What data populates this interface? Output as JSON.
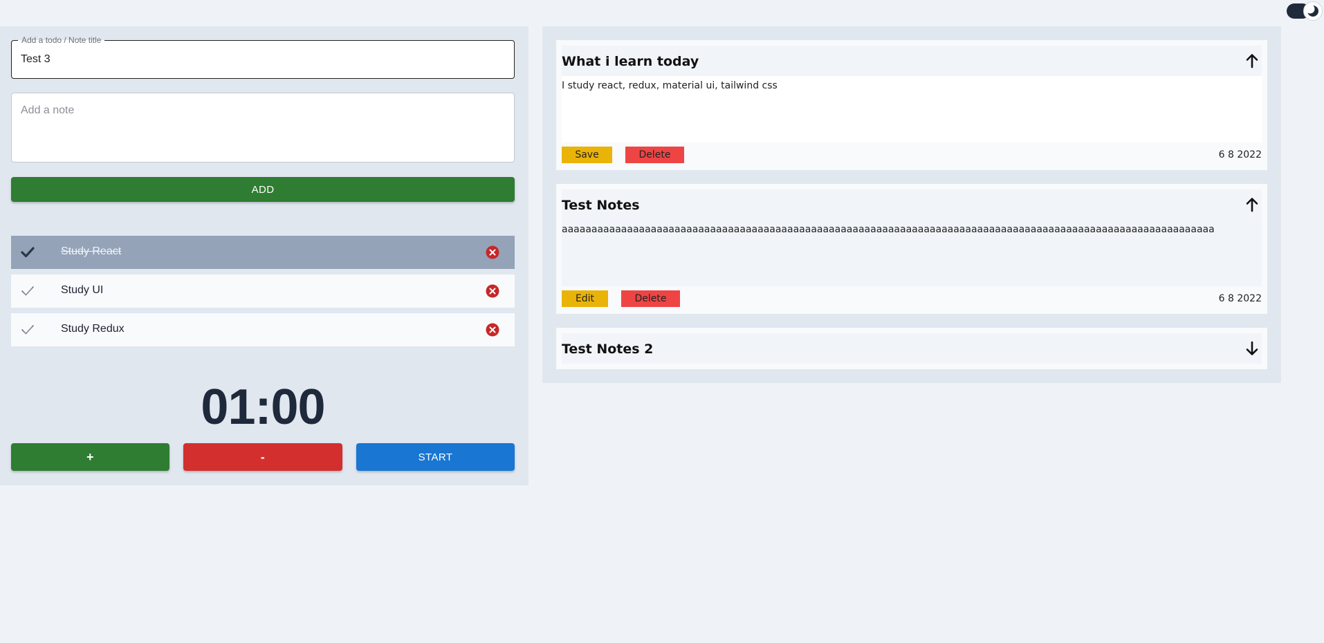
{
  "theme_toggle": {
    "icon": "moon-icon"
  },
  "form": {
    "title_legend": "Add a todo / Note title",
    "title_value": "Test 3",
    "note_placeholder": "Add a note",
    "add_label": "ADD"
  },
  "todos": [
    {
      "label": "Study React",
      "done": true
    },
    {
      "label": "Study UI",
      "done": false
    },
    {
      "label": "Study Redux",
      "done": false
    }
  ],
  "timer": {
    "display": "01:00",
    "plus_label": "+",
    "minus_label": "-",
    "start_label": "START"
  },
  "notes": [
    {
      "title": "What i learn today",
      "body": "I study react, redux, material ui, tailwind css",
      "primary_label": "Save",
      "delete_label": "Delete",
      "date": "6 8 2022",
      "expanded": true
    },
    {
      "title": "Test Notes",
      "body": "aaaaaaaaaaaaaaaaaaaaaaaaaaaaaaaaaaaaaaaaaaaaaaaaaaaaaaaaaaaaaaaaaaaaaaaaaaaaaaaaaaaaaaaaaaaaaaaaaaaaaaaaaaaaaa",
      "primary_label": "Edit",
      "delete_label": "Delete",
      "date": "6 8 2022",
      "expanded": true
    },
    {
      "title": "Test Notes 2",
      "expanded": false
    }
  ],
  "colors": {
    "green": "#2e7d32",
    "red": "#d32f2f",
    "blue": "#1976d2",
    "yellow": "#eab308",
    "delete_red": "#ef4444",
    "done_row": "#94a3b8"
  }
}
